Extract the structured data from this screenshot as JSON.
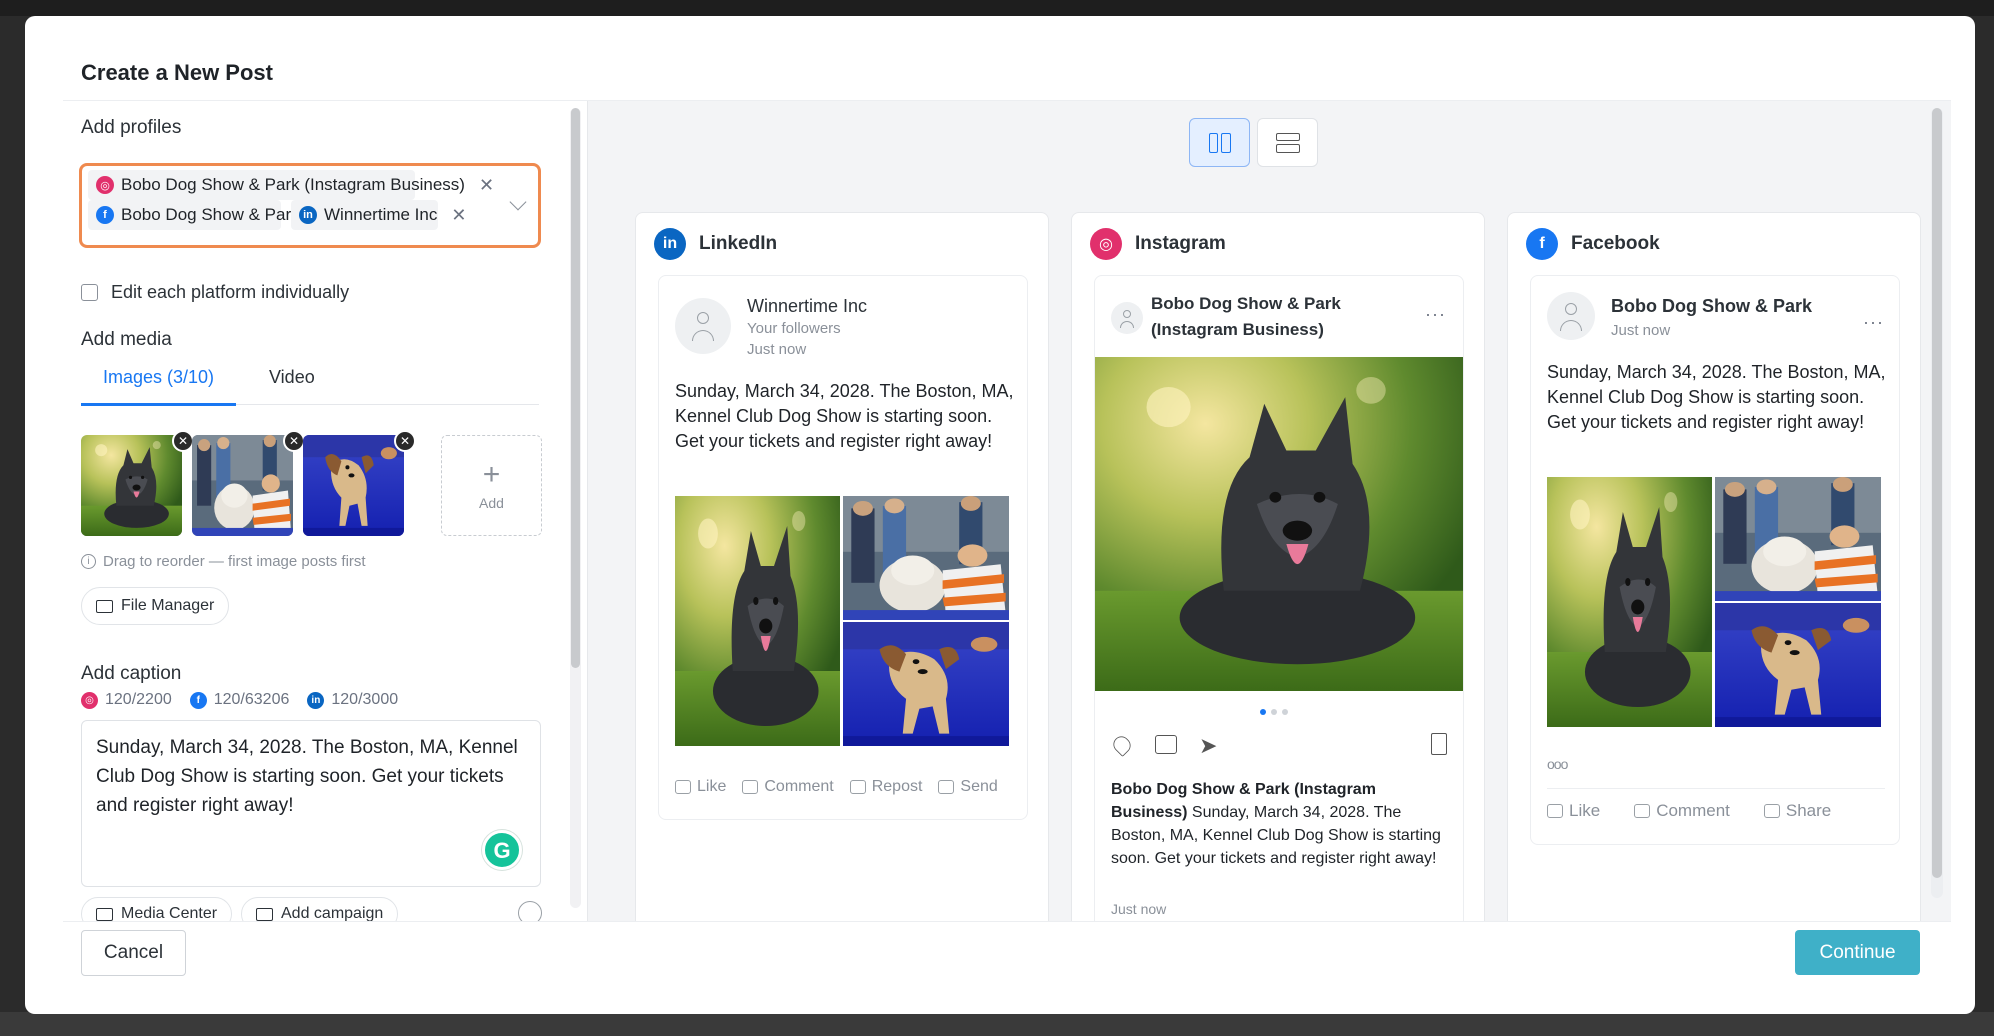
{
  "modal": {
    "title": "Create a New Post"
  },
  "profiles": {
    "label": "Add profiles",
    "chips": [
      {
        "name": "Bobo Dog Show & Park (Instagram Business)",
        "network": "instagram"
      },
      {
        "name": "Bobo Dog Show & Park",
        "network": "facebook"
      },
      {
        "name": "Winnertime Inc",
        "network": "linkedin"
      }
    ]
  },
  "edit_each": {
    "label": "Edit each platform individually",
    "checked": false
  },
  "media": {
    "label": "Add media",
    "tabs": [
      {
        "label": "Images (3/10)",
        "active": true
      },
      {
        "label": "Video",
        "active": false
      }
    ],
    "add_label": "Add",
    "hint": "Drag to reorder — first image posts first",
    "file_manager": "File Manager"
  },
  "caption": {
    "label": "Add caption",
    "counts": {
      "instagram": "120/2200",
      "facebook": "120/63206",
      "linkedin": "120/3000"
    },
    "text": "Sunday, March 34, 2028. The Boston, MA, Kennel Club Dog Show is starting soon. Get your tickets and register right away!",
    "media_center": "Media Center",
    "add_campaign": "Add campaign"
  },
  "preview": {
    "linkedin": {
      "title": "LinkedIn",
      "author": "Winnertime Inc",
      "sub1": "Your followers",
      "sub2": "Just now",
      "text": "Sunday, March 34, 2028. The Boston, MA, Kennel Club Dog Show is starting soon. Get your tickets and register right away!",
      "actions": [
        "Like",
        "Comment",
        "Repost",
        "Send"
      ]
    },
    "instagram": {
      "title": "Instagram",
      "author": "Bobo Dog Show & Park (Instagram Business)",
      "caption_author": "Bobo Dog Show & Park (Instagram Business)",
      "caption_text": " Sunday, March 34, 2028. The Boston, MA, Kennel Club Dog Show is starting soon. Get your tickets and register right away!",
      "time": "Just now"
    },
    "facebook": {
      "title": "Facebook",
      "author": "Bobo Dog Show & Park",
      "time": "Just now",
      "text": "Sunday, March 34, 2028. The Boston, MA, Kennel Club Dog Show is starting soon. Get your tickets and register right away!",
      "reactions": "ooo",
      "actions": [
        "Like",
        "Comment",
        "Share"
      ]
    }
  },
  "footer": {
    "cancel": "Cancel",
    "continue": "Continue"
  },
  "colors": {
    "accent": "#1877f2",
    "continue": "#3fb0c8",
    "highlight": "#ef8a4f",
    "instagram": "#e1306c",
    "facebook": "#1877f2",
    "linkedin": "#0a66c2"
  }
}
